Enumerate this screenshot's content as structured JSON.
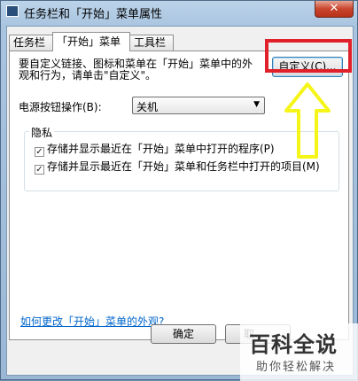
{
  "window": {
    "title": "任务栏和「开始」菜单属性",
    "close_label": "✕",
    "icon": "taskbar-app-icon"
  },
  "tabs": [
    {
      "label": "任务栏"
    },
    {
      "label": "「开始」菜单",
      "active": true
    },
    {
      "label": "工具栏"
    }
  ],
  "panel": {
    "description": "要自定义链接、图标和菜单在「开始」菜单中的外观和行为，请单击\"自定义\"。",
    "customize_button": "自定义(C)...",
    "power_label": "电源按钮操作(B):",
    "power_value": "关机",
    "privacy_title": "隐私",
    "privacy_options": [
      {
        "label": "存储并显示最近在「开始」菜单中打开的程序(P)",
        "checked": true
      },
      {
        "label": "存储并显示最近在「开始」菜单和任务栏中打开的项目(M)",
        "checked": true
      }
    ],
    "help_link": "如何更改「开始」菜单的外观?"
  },
  "footer": {
    "ok_label": "确定",
    "cancel_label": "取"
  },
  "annotation": {
    "highlight_color": "#e0202a",
    "arrow_color": "#f5f51a"
  },
  "watermark": {
    "title": "百科全说",
    "subtitle": "助你轻松解决"
  }
}
